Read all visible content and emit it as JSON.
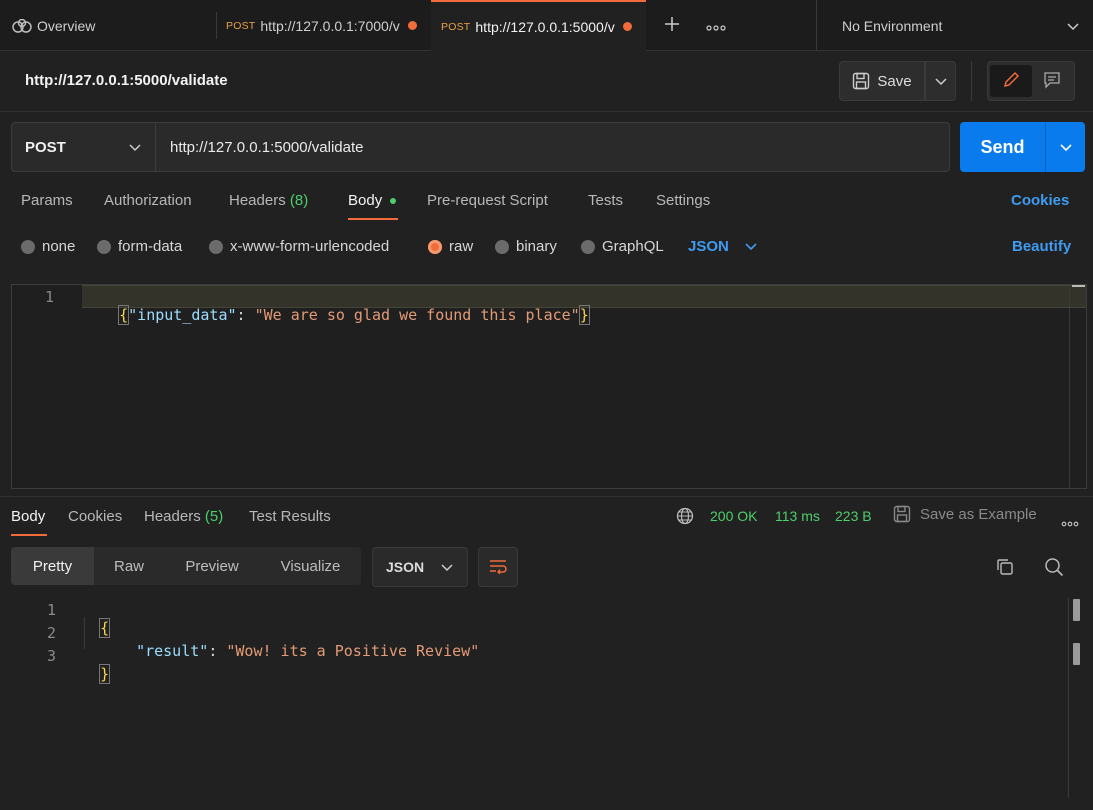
{
  "tabs": {
    "overview_label": "Overview",
    "tab1": {
      "method": "POST",
      "url": "http://127.0.0.1:7000/v"
    },
    "tab2": {
      "method": "POST",
      "url": "http://127.0.0.1:5000/v"
    },
    "environment": "No Environment"
  },
  "request": {
    "title": "http://127.0.0.1:5000/validate",
    "save_label": "Save",
    "method": "POST",
    "url": "http://127.0.0.1:5000/validate",
    "send_label": "Send"
  },
  "request_tabs": {
    "params": "Params",
    "authorization": "Authorization",
    "headers": "Headers",
    "headers_count": "(8)",
    "body": "Body",
    "prerequest": "Pre-request Script",
    "tests": "Tests",
    "settings": "Settings",
    "cookies": "Cookies"
  },
  "body_types": {
    "none": "none",
    "form_data": "form-data",
    "urlencoded": "x-www-form-urlencoded",
    "raw": "raw",
    "binary": "binary",
    "graphql": "GraphQL",
    "format": "JSON",
    "beautify": "Beautify"
  },
  "request_body": {
    "line_number": "1",
    "open": "{",
    "key": "\"input_data\"",
    "colon": ": ",
    "value": "\"We are so glad we found this place\"",
    "close": "}"
  },
  "response_tabs": {
    "body": "Body",
    "cookies": "Cookies",
    "headers": "Headers",
    "headers_count": "(5)",
    "test_results": "Test Results"
  },
  "response_status": {
    "status": "200 OK",
    "time": "113 ms",
    "size": "223 B",
    "save_example": "Save as Example"
  },
  "view_modes": {
    "pretty": "Pretty",
    "raw": "Raw",
    "preview": "Preview",
    "visualize": "Visualize",
    "format": "JSON"
  },
  "response_body": {
    "ln1": "1",
    "ln2": "2",
    "ln3": "3",
    "open": "{",
    "key": "\"result\"",
    "colon": ": ",
    "value": "\"Wow! its a Positive Review\"",
    "close": "}"
  },
  "colors": {
    "accent_orange": "#f26b3a",
    "send_blue": "#097bed",
    "success_green": "#4ccf6a",
    "link_blue": "#3e9bf0"
  }
}
